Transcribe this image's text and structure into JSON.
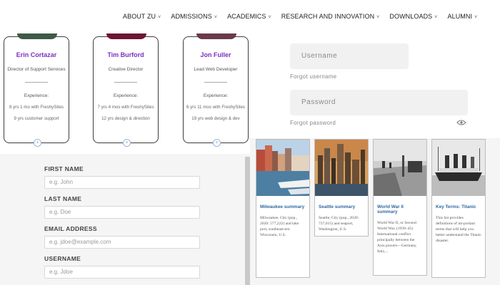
{
  "nav": {
    "items": [
      {
        "label": "ABOUT ZU",
        "has_dropdown": true
      },
      {
        "label": "ADMISSIONS",
        "has_dropdown": true
      },
      {
        "label": "ACADEMICS",
        "has_dropdown": true
      },
      {
        "label": "RESEARCH AND INNOVATION",
        "has_dropdown": true
      },
      {
        "label": "DOWNLOADS",
        "has_dropdown": true
      },
      {
        "label": "ALUMNI",
        "has_dropdown": true
      }
    ]
  },
  "team": [
    {
      "name": "Erin Cortazar",
      "role": "Director of Support Services",
      "experience_label": "Experience:",
      "lines": [
        "8 yrs 1 mo with FreshySites",
        "9 yrs customer support"
      ]
    },
    {
      "name": "Tim Burford",
      "role": "Creative Director",
      "experience_label": "Experience:",
      "lines": [
        "7 yrs 4 mos with FreshySites",
        "12 yrs design & direction"
      ]
    },
    {
      "name": "Jon Fuller",
      "role": "Lead Web Developer",
      "experience_label": "Experience:",
      "lines": [
        "6 yrs 11 mos with FreshySites",
        "19 yrs web design & dev"
      ]
    }
  ],
  "form": {
    "fields": [
      {
        "label": "FIRST NAME",
        "placeholder": "e.g. John"
      },
      {
        "label": "LAST NAME",
        "placeholder": "e.g. Doe"
      },
      {
        "label": "EMAIL ADDRESS",
        "placeholder": "e.g. jdoe@example.com"
      },
      {
        "label": "USERNAME",
        "placeholder": "e.g. Jdoe"
      }
    ]
  },
  "login": {
    "username_placeholder": "Username",
    "forgot_username": "Forgot username",
    "password_placeholder": "Password",
    "forgot_password": "Forgot password",
    "eye_icon": "eye-icon"
  },
  "tiles": [
    {
      "title": "Milwaukee summary",
      "text": "Milwaukee, City (pop., 2020: 577,222) and lake port, southeast-ern Wisconsin, U.S.",
      "image": "milwaukee-river-photo"
    },
    {
      "title": "Seattle summary",
      "text": "Seattle, City (pop., 2020: 737,015) and seaport, Washington, U.S.",
      "image": "seattle-skyline-photo"
    },
    {
      "title": "World War II summary",
      "text": "World War II, or Second World War, (1939–45) International conflict principally between the Axis powers—Germany, Italy,...",
      "image": "wwii-photo"
    },
    {
      "title": "Key Terms: Titanic",
      "text": "This list provides definitions of im-portant terms that will help you better understand the Titanic disaster.",
      "image": "titanic-photo"
    }
  ],
  "colors": {
    "accent_name": "#7b2fbf",
    "link_blue": "#2f69a3",
    "panel_gray": "#f5f5f5"
  }
}
